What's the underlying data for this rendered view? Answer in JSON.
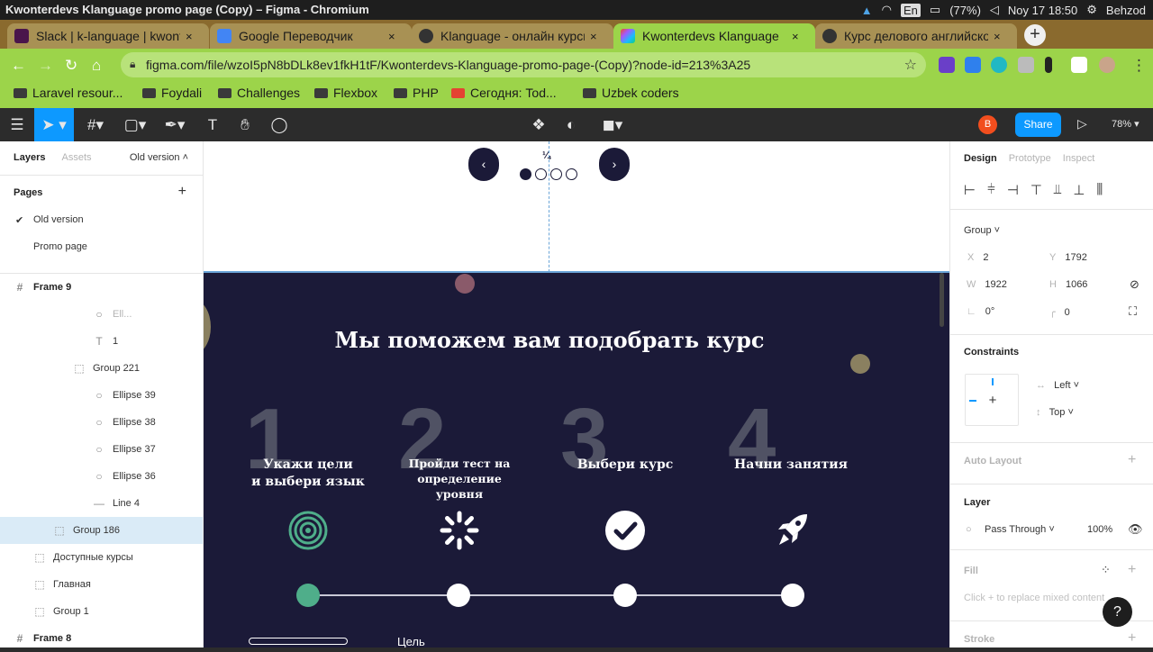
{
  "os": {
    "window_title": "Kwonterdevs Klanguage promo page (Copy) – Figma - Chromium",
    "battery": "(77%)",
    "keyboard": "En",
    "datetime": "Noy 17 18:50",
    "user": "Behzod"
  },
  "browser": {
    "tabs": [
      {
        "label": "Slack | k-language | kwont",
        "color": "#4a154b"
      },
      {
        "label": "Google Переводчик",
        "color": "#4285f4"
      },
      {
        "label": "Klanguage - онлайн курсы",
        "color": "#333333"
      },
      {
        "label": "Kwonterdevs Klanguage",
        "color": "#f24e1e"
      },
      {
        "label": "Курс делового английского",
        "color": "#333333"
      }
    ],
    "tab_close": "×",
    "new_tab": "+",
    "url": "figma.com/file/wzoI5pN8bDLk8ev1fkH1tF/Kwonterdevs-Klanguage-promo-page-(Copy)?node-id=213%3A25",
    "bookmarks": [
      "Laravel resour...",
      "Foydali",
      "Challenges",
      "Flexbox",
      "PHP",
      "Сегодня: Tod...",
      "Uzbek coders"
    ]
  },
  "figma_toolbar": {
    "avatar_letter": "B",
    "share_label": "Share",
    "zoom": "78%"
  },
  "left_panel": {
    "tab_layers": "Layers",
    "tab_assets": "Assets",
    "page_switch": "Old version",
    "pages_heading": "Pages",
    "pages": [
      "Old version",
      "Promo page"
    ],
    "layers": [
      {
        "label": "Frame 9",
        "icon": "#",
        "indent": 0,
        "type": "frame"
      },
      {
        "label": "Ell...",
        "icon": "○",
        "indent": 4,
        "type": "ghost"
      },
      {
        "label": "1",
        "icon": "T",
        "indent": 4,
        "type": "text"
      },
      {
        "label": "Group 221",
        "icon": "⬚",
        "indent": 3,
        "type": "group"
      },
      {
        "label": "Ellipse 39",
        "icon": "○",
        "indent": 4,
        "type": "ellipse"
      },
      {
        "label": "Ellipse 38",
        "icon": "○",
        "indent": 4,
        "type": "ellipse"
      },
      {
        "label": "Ellipse 37",
        "icon": "○",
        "indent": 4,
        "type": "ellipse"
      },
      {
        "label": "Ellipse 36",
        "icon": "○",
        "indent": 4,
        "type": "ellipse"
      },
      {
        "label": "Line 4",
        "icon": "—",
        "indent": 4,
        "type": "line"
      },
      {
        "label": "Group 186",
        "icon": "⬚",
        "indent": 2,
        "type": "selected"
      },
      {
        "label": "Доступные курсы",
        "icon": "⬚",
        "indent": 1,
        "type": "group"
      },
      {
        "label": "Главная",
        "icon": "⬚",
        "indent": 1,
        "type": "group"
      },
      {
        "label": "Group 1",
        "icon": "⬚",
        "indent": 1,
        "type": "group"
      },
      {
        "label": "Frame 8",
        "icon": "#",
        "indent": 0,
        "type": "frame"
      }
    ]
  },
  "canvas": {
    "slider_counter": "¼",
    "heading": "Мы поможем вам подобрать курс",
    "steps": [
      {
        "number": "1",
        "line1": "Укажи цели",
        "line2": "и выбери язык",
        "line3": "",
        "icon": "target-icon"
      },
      {
        "number": "2",
        "line1": "Пройди тест на",
        "line2": "определение",
        "line3": "уровня",
        "icon": "loading-icon"
      },
      {
        "number": "3",
        "line1": "Выбери курс",
        "line2": "",
        "line3": "",
        "icon": "check-circle-icon"
      },
      {
        "number": "4",
        "line1": "Начни занятия",
        "line2": "",
        "line3": "",
        "icon": "rocket-icon"
      }
    ],
    "progress_active": 1,
    "progress_total": 4,
    "goal_label": "Цель"
  },
  "right_panel": {
    "tab_design": "Design",
    "tab_prototype": "Prototype",
    "tab_inspect": "Inspect",
    "group_label": "Group",
    "x_label": "X",
    "x": "2",
    "y_label": "Y",
    "y": "1792",
    "w_label": "W",
    "w": "1922",
    "h_label": "H",
    "h": "1066",
    "rotation": "0°",
    "radius": "0",
    "constraints_heading": "Constraints",
    "constraint_h": "Left",
    "constraint_v": "Top",
    "auto_layout": "Auto Layout",
    "layer_heading": "Layer",
    "blend": "Pass Through",
    "opacity": "100%",
    "fill_heading": "Fill",
    "fill_hint": "Click + to replace mixed content",
    "stroke_heading": "Stroke"
  },
  "colors": {
    "browser_accent": "#9cd44a",
    "figma_blue": "#0d99ff",
    "section_bg": "#1b1a38",
    "progress_green": "#4fae8a"
  }
}
